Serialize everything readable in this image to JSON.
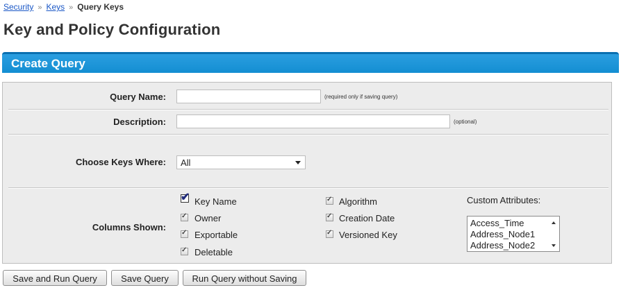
{
  "breadcrumb": {
    "items": [
      "Security",
      "Keys"
    ],
    "separator": "»",
    "current": "Query Keys"
  },
  "page_title": "Key and Policy Configuration",
  "section": {
    "title": "Create Query",
    "accent_color": "#1e96d8"
  },
  "form": {
    "query_name": {
      "label": "Query Name:",
      "value": "",
      "hint": "(required only if saving query)"
    },
    "description": {
      "label": "Description:",
      "value": "",
      "hint": "(optional)"
    },
    "choose_keys": {
      "label": "Choose Keys Where:",
      "selected": "All"
    },
    "columns": {
      "label": "Columns Shown:",
      "col1": [
        "Key Name",
        "Owner",
        "Exportable",
        "Deletable"
      ],
      "col2": [
        "Algorithm",
        "Creation Date",
        "Versioned Key"
      ],
      "custom_label": "Custom Attributes:",
      "custom_options": [
        "Access_Time",
        "Address_Node1",
        "Address_Node2"
      ]
    }
  },
  "buttons": {
    "save_run": "Save and Run Query",
    "save": "Save Query",
    "run_no_save": "Run Query without Saving"
  }
}
